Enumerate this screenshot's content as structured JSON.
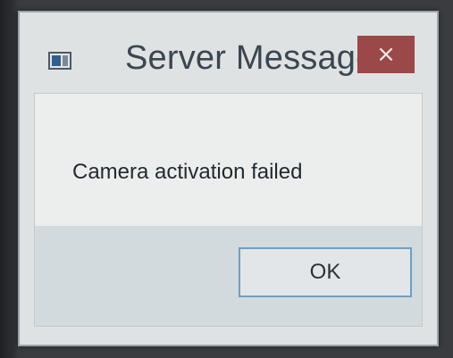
{
  "window": {
    "title": "Server Message",
    "icon": "app-window-icon",
    "close_glyph": "×"
  },
  "message": {
    "text": "Camera activation failed"
  },
  "buttons": {
    "ok_label": "OK"
  },
  "colors": {
    "close_button": "#9b4848",
    "ok_border": "#6e9fc4",
    "dialog_bg": "#dfe2e3",
    "footer_bg": "#d3dadd"
  }
}
